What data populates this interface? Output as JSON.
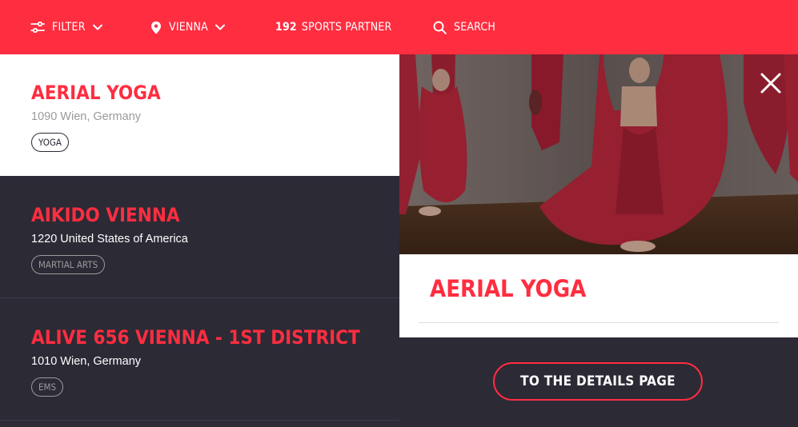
{
  "colors": {
    "accent": "#ff2d40",
    "dark_bg": "#2c2a35",
    "white": "#ffffff",
    "muted": "#9a9a9a"
  },
  "topbar": {
    "filter": {
      "label": "FILTER",
      "icon": "sliders-icon"
    },
    "city": {
      "label": "VIENNA",
      "icon": "map-pin-icon"
    },
    "count": {
      "value": "192",
      "label": "SPORTS PARTNER"
    },
    "search": {
      "label": "SEARCH",
      "icon": "search-icon"
    }
  },
  "partners": [
    {
      "name": "AERIAL YOGA",
      "address": "1090 Wien, Germany",
      "tag": "YOGA",
      "selected": true
    },
    {
      "name": "AIKIDO VIENNA",
      "address": "1220 United States of America",
      "tag": "MARTIAL ARTS",
      "selected": false
    },
    {
      "name": "ALIVE 656 VIENNA - 1ST DISTRICT",
      "address": "1010 Wien, Germany",
      "tag": "EMS",
      "selected": false
    }
  ],
  "detail": {
    "title": "AERIAL YOGA",
    "button_label": "TO THE DETAILS PAGE",
    "close_icon": "close-icon",
    "photo": "aerial-yoga-hammocks-photo"
  }
}
